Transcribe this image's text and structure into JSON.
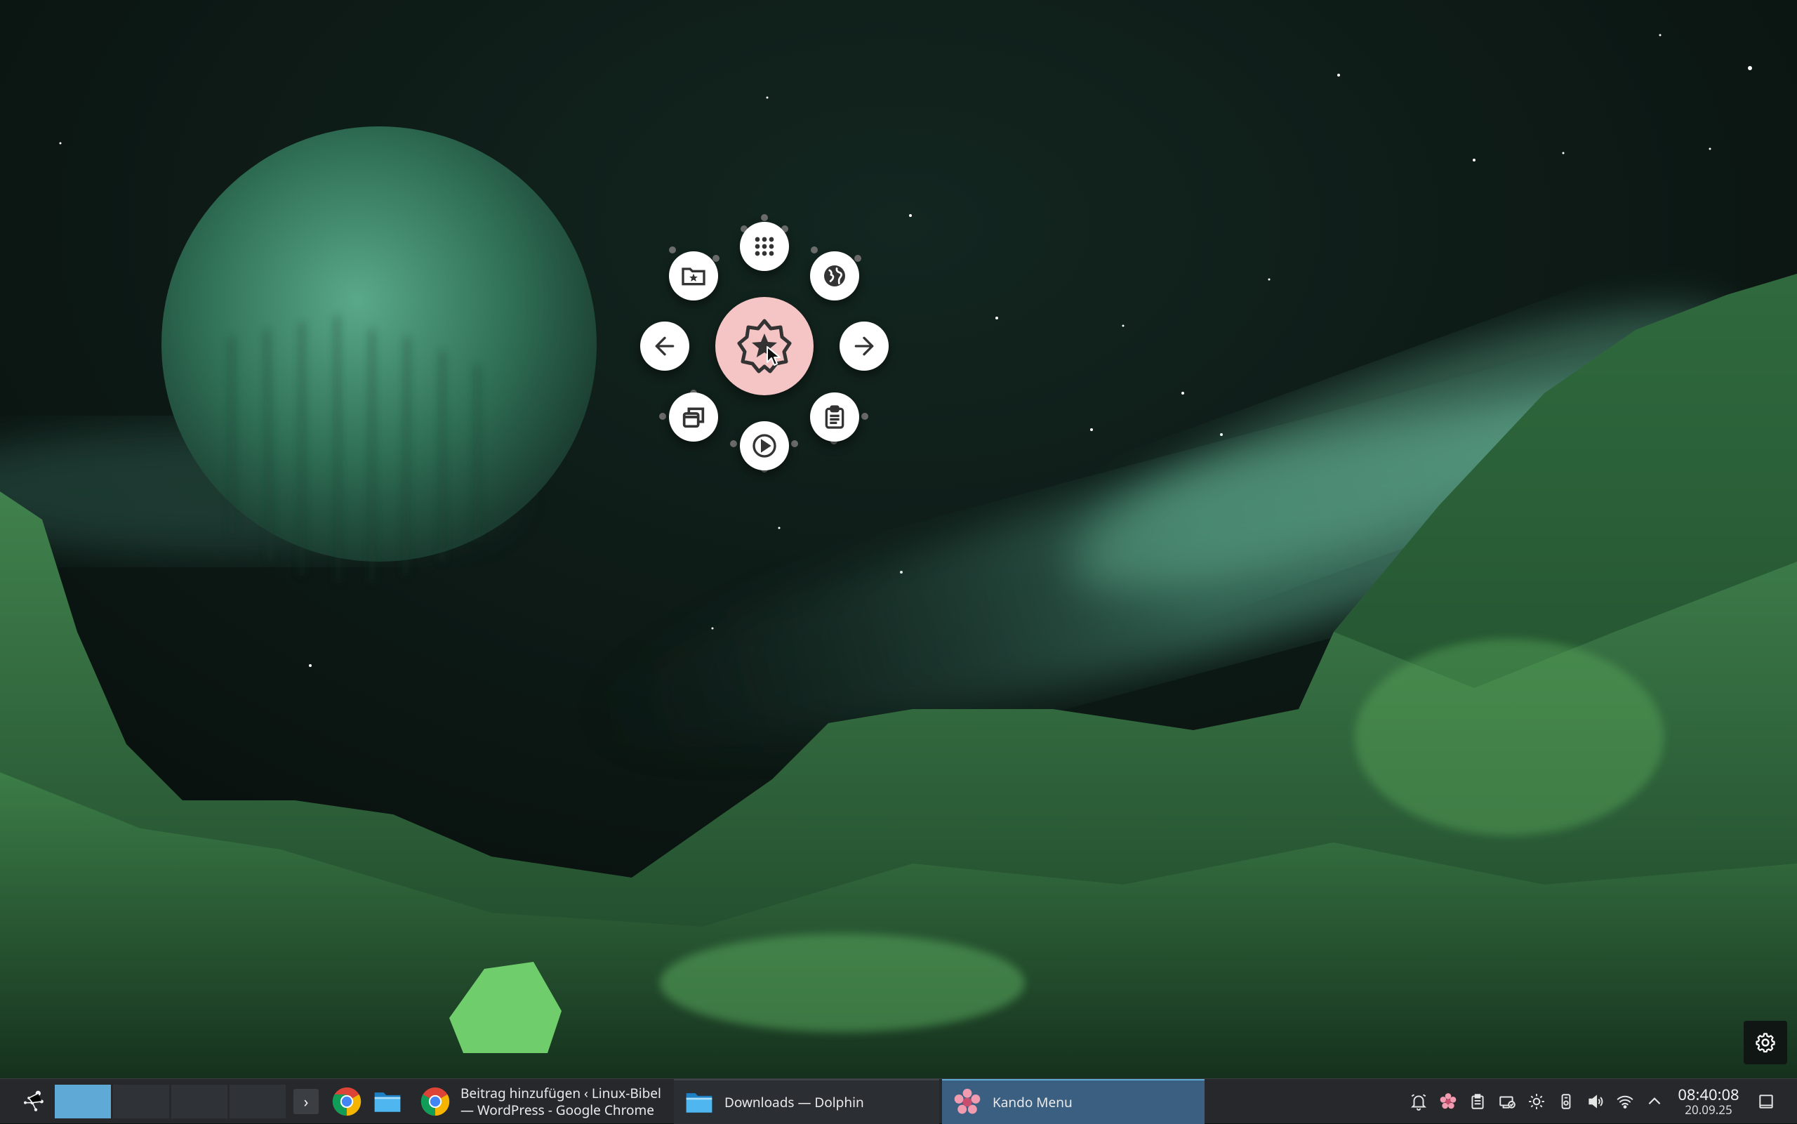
{
  "desktop": {
    "wallpaper": "alien-landscape-green-moon",
    "colors": {
      "sky": "#0d1714",
      "moon": "#3f8f69",
      "aurora": "#6fcaa4",
      "rocks": "#2f7a3d"
    }
  },
  "kando_menu": {
    "center_icon": "star-badge-icon",
    "center_color": "#f5c4c4",
    "items": [
      {
        "name": "apps",
        "icon": "grid-icon"
      },
      {
        "name": "web",
        "icon": "globe-icon"
      },
      {
        "name": "next",
        "icon": "arrow-right-icon"
      },
      {
        "name": "clipboard",
        "icon": "clipboard-icon"
      },
      {
        "name": "media",
        "icon": "play-circle-icon"
      },
      {
        "name": "windows",
        "icon": "windows-icon"
      },
      {
        "name": "back",
        "icon": "arrow-left-icon"
      },
      {
        "name": "favorites",
        "icon": "folder-star-icon"
      }
    ]
  },
  "taskbar": {
    "pager": {
      "desktops": 4,
      "active": 1
    },
    "tasks": [
      {
        "title": "Beitrag hinzufügen ‹ Linux-Bibel\n— WordPress - Google Chrome",
        "icon": "chrome-icon"
      },
      {
        "title": "Downloads — Dolphin",
        "icon": "folder-icon"
      },
      {
        "title": "Kando Menu",
        "icon": "kando-icon"
      }
    ],
    "clock": {
      "time": "08:40:08",
      "date": "20.09.25"
    },
    "accent": "#5ea9d6"
  }
}
